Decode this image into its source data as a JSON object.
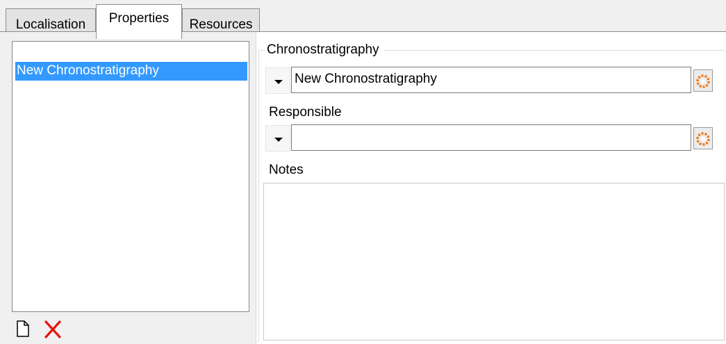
{
  "tabs": [
    {
      "label": "Localisation",
      "active": false
    },
    {
      "label": "Properties",
      "active": true
    },
    {
      "label": "Resources",
      "active": false
    }
  ],
  "list": {
    "items": [
      "New Chronostratigraphy"
    ],
    "selected_index": 0
  },
  "toolbar": {
    "new_icon": "new-document-icon",
    "delete_icon": "delete-x-icon"
  },
  "group": {
    "title": "Chronostratigraphy",
    "chrono_value": "New Chronostratigraphy",
    "responsible_label": "Responsible",
    "responsible_value": "",
    "notes_label": "Notes",
    "notes_value": ""
  },
  "colors": {
    "selection": "#3399ff",
    "delete": "#e8110c",
    "edit_icon": "#f07a1a"
  }
}
